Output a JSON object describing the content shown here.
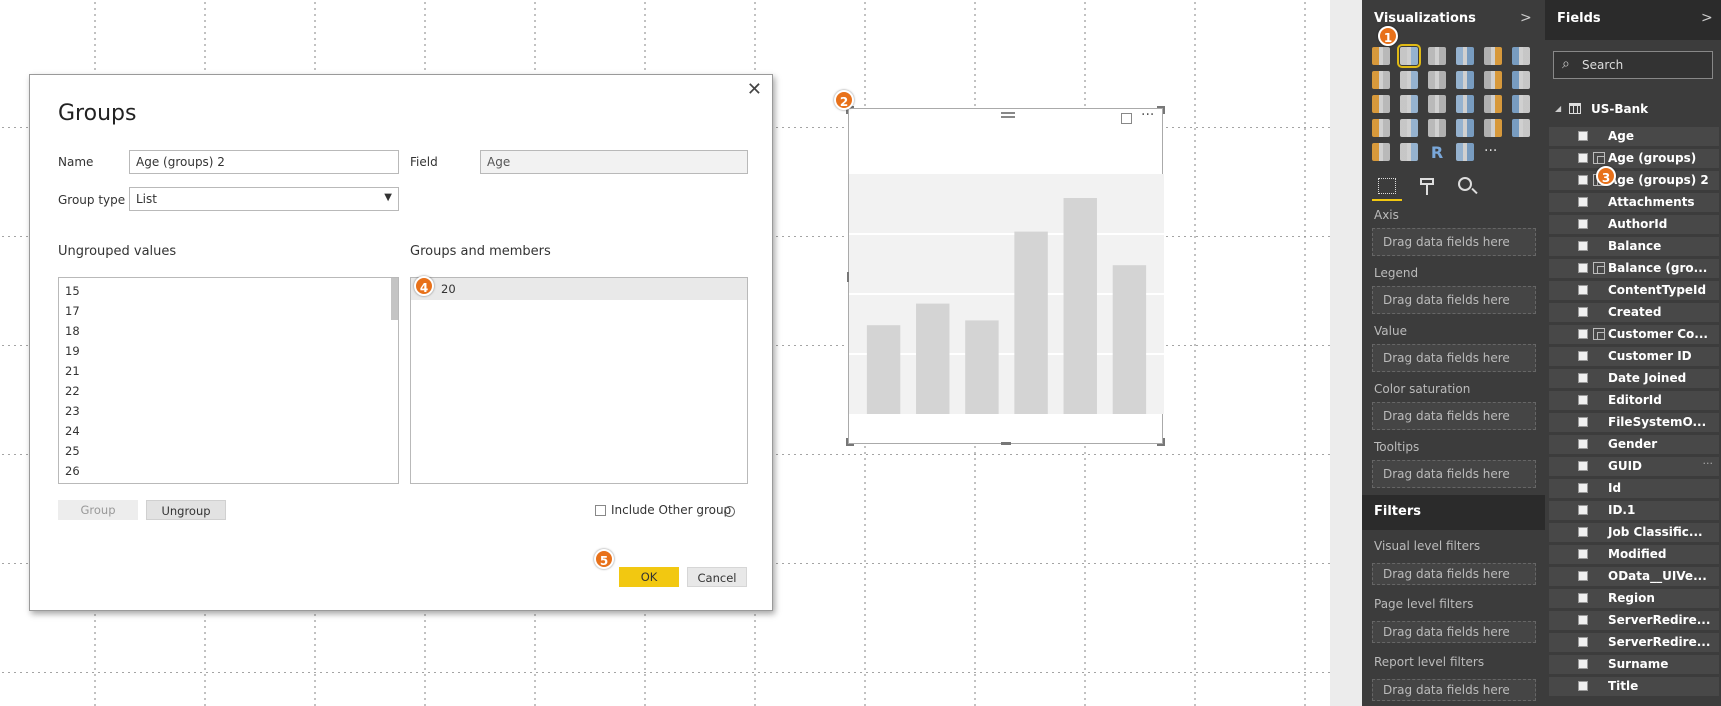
{
  "dialog": {
    "title": "Groups",
    "close_icon": "close-icon",
    "name_label": "Name",
    "name_value": "Age (groups) 2",
    "field_label": "Field",
    "field_value": "Age",
    "group_type_label": "Group type",
    "group_type_value": "List",
    "ungrouped_title": "Ungrouped values",
    "ungrouped_values": [
      "15",
      "17",
      "18",
      "19",
      "21",
      "22",
      "23",
      "24",
      "25",
      "26"
    ],
    "groups_title": "Groups and members",
    "groups": [
      "20"
    ],
    "group_button": "Group",
    "ungroup_button": "Ungroup",
    "include_other_label": "Include Other group",
    "ok_button": "OK",
    "cancel_button": "Cancel"
  },
  "badges": [
    "1",
    "2",
    "3",
    "4",
    "5"
  ],
  "chart_data": {
    "type": "bar",
    "categories": [
      "",
      "",
      "",
      "",
      "",
      ""
    ],
    "values": [
      37,
      46,
      39,
      76,
      90,
      62
    ],
    "ylim": [
      0,
      100
    ],
    "bar_color": "#d4d4d4",
    "background": "#f2f2f2"
  },
  "visualizations": {
    "title": "Visualizations",
    "wells": [
      {
        "label": "Axis",
        "placeholder": "Drag data fields here"
      },
      {
        "label": "Legend",
        "placeholder": "Drag data fields here"
      },
      {
        "label": "Value",
        "placeholder": "Drag data fields here"
      },
      {
        "label": "Color saturation",
        "placeholder": "Drag data fields here"
      },
      {
        "label": "Tooltips",
        "placeholder": "Drag data fields here"
      }
    ],
    "filters_title": "Filters",
    "filters": [
      {
        "label": "Visual level filters",
        "placeholder": "Drag data fields here"
      },
      {
        "label": "Page level filters",
        "placeholder": "Drag data fields here"
      },
      {
        "label": "Report level filters",
        "placeholder": "Drag data fields here"
      }
    ],
    "accent": "#f2c811"
  },
  "fields": {
    "title": "Fields",
    "search_placeholder": "Search",
    "table_name": "US-Bank",
    "items": [
      {
        "name": "Age",
        "icon": "none"
      },
      {
        "name": "Age (groups)",
        "icon": "group"
      },
      {
        "name": "Age (groups) 2",
        "icon": "group"
      },
      {
        "name": "Attachments",
        "icon": "none"
      },
      {
        "name": "AuthorId",
        "icon": "none"
      },
      {
        "name": "Balance",
        "icon": "none"
      },
      {
        "name": "Balance (gro...",
        "icon": "group"
      },
      {
        "name": "ContentTypeId",
        "icon": "none"
      },
      {
        "name": "Created",
        "icon": "none"
      },
      {
        "name": "Customer Co...",
        "icon": "hierarchy"
      },
      {
        "name": "Customer ID",
        "icon": "none"
      },
      {
        "name": "Date Joined",
        "icon": "none"
      },
      {
        "name": "EditorId",
        "icon": "none"
      },
      {
        "name": "FileSystemO...",
        "icon": "none"
      },
      {
        "name": "Gender",
        "icon": "none"
      },
      {
        "name": "GUID",
        "icon": "none",
        "more": "···"
      },
      {
        "name": "Id",
        "icon": "none"
      },
      {
        "name": "ID.1",
        "icon": "none"
      },
      {
        "name": "Job Classific...",
        "icon": "none"
      },
      {
        "name": "Modified",
        "icon": "none"
      },
      {
        "name": "OData__UIVe...",
        "icon": "none"
      },
      {
        "name": "Region",
        "icon": "none"
      },
      {
        "name": "ServerRedire...",
        "icon": "none"
      },
      {
        "name": "ServerRedire...",
        "icon": "none"
      },
      {
        "name": "Surname",
        "icon": "none"
      },
      {
        "name": "Title",
        "icon": "none"
      }
    ]
  }
}
